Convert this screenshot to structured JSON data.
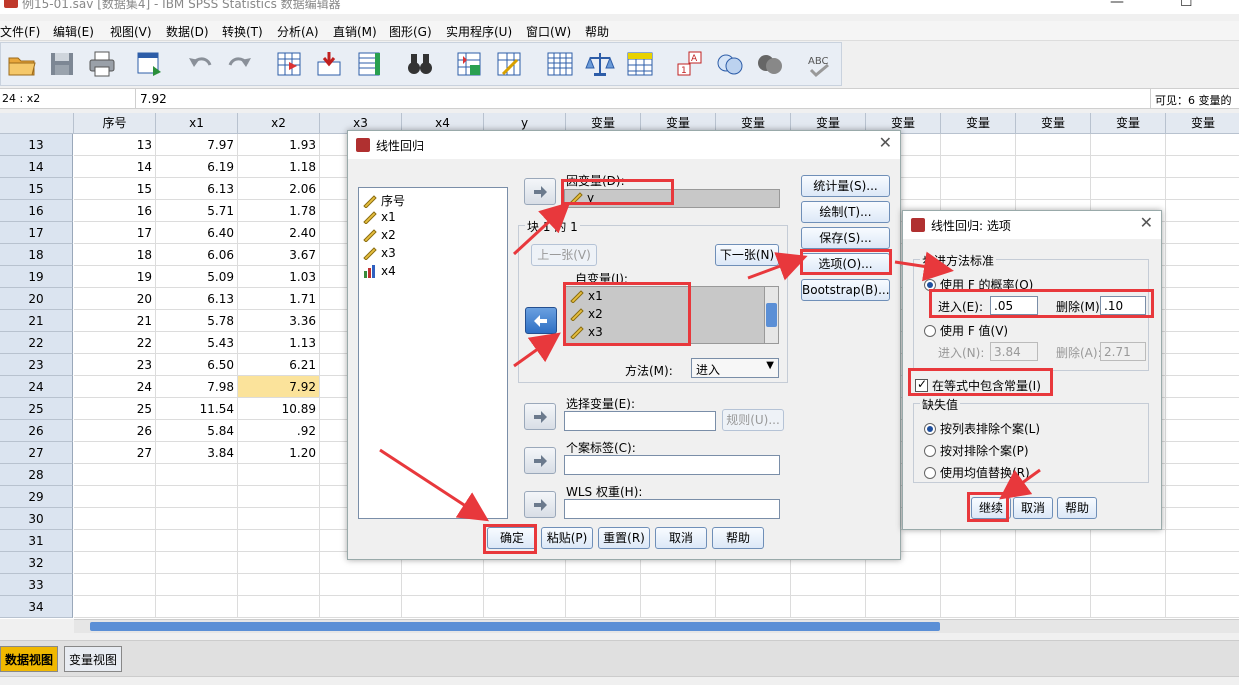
{
  "window": {
    "title": "例15-01.sav [数据集4] - IBM SPSS Statistics 数据编辑器"
  },
  "menu": [
    "文件(F)",
    "编辑(E)",
    "视图(V)",
    "数据(D)",
    "转换(T)",
    "分析(A)",
    "直销(M)",
    "图形(G)",
    "实用程序(U)",
    "窗口(W)",
    "帮助"
  ],
  "cellbar": {
    "ref": "24 : x2",
    "value": "7.92",
    "visible": "可见：6 变量的"
  },
  "grid": {
    "headers": [
      "序号",
      "x1",
      "x2",
      "x3",
      "x4",
      "y",
      "变量",
      "变量",
      "变量",
      "变量",
      "变量",
      "变量",
      "变量",
      "变量",
      "变量"
    ],
    "rows": [
      {
        "n": "13",
        "c": [
          "13",
          "7.97",
          "1.93"
        ]
      },
      {
        "n": "14",
        "c": [
          "14",
          "6.19",
          "1.18"
        ]
      },
      {
        "n": "15",
        "c": [
          "15",
          "6.13",
          "2.06"
        ]
      },
      {
        "n": "16",
        "c": [
          "16",
          "5.71",
          "1.78"
        ]
      },
      {
        "n": "17",
        "c": [
          "17",
          "6.40",
          "2.40"
        ]
      },
      {
        "n": "18",
        "c": [
          "18",
          "6.06",
          "3.67"
        ]
      },
      {
        "n": "19",
        "c": [
          "19",
          "5.09",
          "1.03"
        ]
      },
      {
        "n": "20",
        "c": [
          "20",
          "6.13",
          "1.71"
        ]
      },
      {
        "n": "21",
        "c": [
          "21",
          "5.78",
          "3.36"
        ]
      },
      {
        "n": "22",
        "c": [
          "22",
          "5.43",
          "1.13"
        ]
      },
      {
        "n": "23",
        "c": [
          "23",
          "6.50",
          "6.21"
        ]
      },
      {
        "n": "24",
        "c": [
          "24",
          "7.98",
          "7.92"
        ]
      },
      {
        "n": "25",
        "c": [
          "25",
          "11.54",
          "10.89"
        ]
      },
      {
        "n": "26",
        "c": [
          "26",
          "5.84",
          ".92"
        ]
      },
      {
        "n": "27",
        "c": [
          "27",
          "3.84",
          "1.20"
        ]
      },
      {
        "n": "28",
        "c": [
          "",
          "",
          ""
        ]
      },
      {
        "n": "29",
        "c": [
          "",
          "",
          ""
        ]
      },
      {
        "n": "30",
        "c": [
          "",
          "",
          ""
        ]
      },
      {
        "n": "31",
        "c": [
          "",
          "",
          ""
        ]
      },
      {
        "n": "32",
        "c": [
          "",
          "",
          ""
        ]
      },
      {
        "n": "33",
        "c": [
          "",
          "",
          ""
        ]
      },
      {
        "n": "34",
        "c": [
          "",
          "",
          ""
        ]
      }
    ]
  },
  "tabs": {
    "data_view": "数据视图",
    "variable_view": "变量视图"
  },
  "regression": {
    "title": "线性回归",
    "source_vars": [
      "序号",
      "x1",
      "x2",
      "x3",
      "x4"
    ],
    "dependent_label": "因变量(D):",
    "dependent_value": "y",
    "block_label": "块 1 的 1",
    "prev_btn": "上一张(V)",
    "next_btn": "下一张(N)",
    "independent_label": "自变量(I):",
    "independents": [
      "x1",
      "x2",
      "x3"
    ],
    "method_label": "方法(M):",
    "method_value": "进入",
    "selection_label": "选择变量(E):",
    "rule_btn": "规则(U)...",
    "case_label": "个案标签(C):",
    "wls_label": "WLS 权重(H):",
    "side_buttons": [
      "统计量(S)...",
      "绘制(T)...",
      "保存(S)...",
      "选项(O)...",
      "Bootstrap(B)..."
    ],
    "bottom_buttons": [
      "确定",
      "粘贴(P)",
      "重置(R)",
      "取消",
      "帮助"
    ]
  },
  "options": {
    "title": "线性回归: 选项",
    "stepping_title": "步进方法标准",
    "use_prob": "使用 F 的概率(O)",
    "entry_label": "进入(E):",
    "entry_value": ".05",
    "removal_label": "删除(M):",
    "removal_value": ".10",
    "use_fval": "使用 F 值(V)",
    "entry_f_label": "进入(N):",
    "entry_f_value": "3.84",
    "removal_f_label": "删除(A):",
    "removal_f_value": "2.71",
    "include_constant": "在等式中包含常量(I)",
    "missing_title": "缺失值",
    "missing_opts": [
      "按列表排除个案(L)",
      "按对排除个案(P)",
      "使用均值替换(R)"
    ],
    "buttons": [
      "继续",
      "取消",
      "帮助"
    ]
  }
}
